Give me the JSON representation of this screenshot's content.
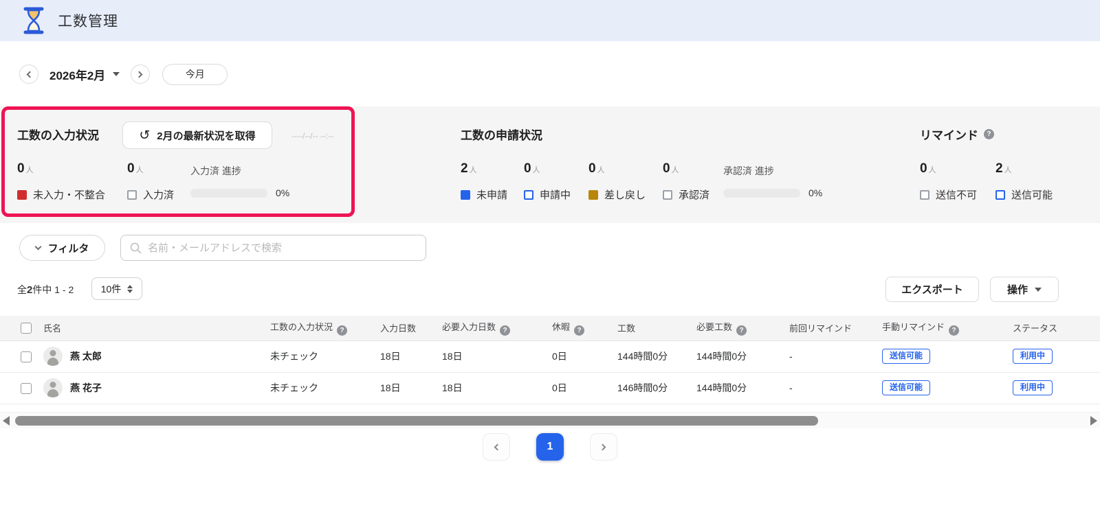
{
  "colors": {
    "accent_blue": "#2563eb",
    "alert_red": "#d02e2e",
    "warn_gold": "#b8860b",
    "neutral_grey": "#9aa0a6",
    "annotation_pink": "#ee1453",
    "header_bg": "#e7eefa"
  },
  "icons": {
    "hourglass": "hourglass-svg",
    "refresh": "↺",
    "help": "?",
    "caret_down": "css-triangle-down",
    "chevron_left": "css-chevron-left",
    "chevron_right": "css-chevron-right",
    "chevron_down": "css-chevron-down",
    "search": "magnifier-svg",
    "page_size_spinner": "css-triangles-up-down",
    "person_avatar": "css-person-shape"
  },
  "header": {
    "title": "工数管理"
  },
  "date_nav": {
    "current_month": "2026年2月",
    "today_label": "今月"
  },
  "panels": {
    "input_status": {
      "title": "工数の入力状況",
      "refresh_button_label": "2月の最新状況を取得",
      "last_fetched": "----/--/-- --:--",
      "stats": [
        {
          "value": "0",
          "unit": "人",
          "label": "未入力・不整合",
          "swatch": "filled",
          "color": "#d02e2e"
        },
        {
          "value": "0",
          "unit": "人",
          "label": "入力済",
          "swatch": "outline",
          "color": "#9aa0a6"
        }
      ],
      "progress": {
        "label": "入力済 進捗",
        "percent": 0,
        "percent_label": "0%"
      }
    },
    "request_status": {
      "title": "工数の申請状況",
      "stats": [
        {
          "value": "2",
          "unit": "人",
          "label": "未申請",
          "swatch": "filled",
          "color": "#2563eb"
        },
        {
          "value": "0",
          "unit": "人",
          "label": "申請中",
          "swatch": "outline",
          "color": "#2563eb"
        },
        {
          "value": "0",
          "unit": "人",
          "label": "差し戻し",
          "swatch": "filled",
          "color": "#b8860b"
        },
        {
          "value": "0",
          "unit": "人",
          "label": "承認済",
          "swatch": "outline",
          "color": "#9aa0a6"
        }
      ],
      "progress": {
        "label": "承認済 進捗",
        "percent": 0,
        "percent_label": "0%"
      }
    },
    "remind": {
      "title": "リマインド",
      "stats": [
        {
          "value": "0",
          "unit": "人",
          "label": "送信不可",
          "swatch": "outline",
          "color": "#9aa0a6"
        },
        {
          "value": "2",
          "unit": "人",
          "label": "送信可能",
          "swatch": "outline",
          "color": "#2563eb"
        }
      ]
    }
  },
  "filter": {
    "button_label": "フィルタ",
    "search_placeholder": "名前・メールアドレスで検索"
  },
  "list_controls": {
    "count_prefix": "全",
    "count_total": "2",
    "count_suffix": "件中 1 - 2",
    "page_size": "10件",
    "export_label": "エクスポート",
    "actions_label": "操作"
  },
  "table": {
    "columns": [
      {
        "key": "name",
        "label": "氏名",
        "help": false
      },
      {
        "key": "input_status",
        "label": "工数の入力状況",
        "help": true
      },
      {
        "key": "input_days",
        "label": "入力日数",
        "help": false
      },
      {
        "key": "required_days",
        "label": "必要入力日数",
        "help": true
      },
      {
        "key": "vacation",
        "label": "休暇",
        "help": true
      },
      {
        "key": "hours",
        "label": "工数",
        "help": false
      },
      {
        "key": "required_hours",
        "label": "必要工数",
        "help": true
      },
      {
        "key": "last_remind",
        "label": "前回リマインド",
        "help": false
      },
      {
        "key": "manual_remind",
        "label": "手動リマインド",
        "help": true
      },
      {
        "key": "status",
        "label": "ステータス",
        "help": false
      }
    ],
    "rows": [
      {
        "name": "燕 太郎",
        "input_status": "未チェック",
        "input_days": "18日",
        "required_days": "18日",
        "vacation": "0日",
        "hours": "144時間0分",
        "required_hours": "144時間0分",
        "last_remind": "-",
        "manual_remind": "送信可能",
        "status": "利用中"
      },
      {
        "name": "燕 花子",
        "input_status": "未チェック",
        "input_days": "18日",
        "required_days": "18日",
        "vacation": "0日",
        "hours": "146時間0分",
        "required_hours": "144時間0分",
        "last_remind": "-",
        "manual_remind": "送信可能",
        "status": "利用中"
      }
    ]
  },
  "pagination": {
    "current_page": "1"
  }
}
